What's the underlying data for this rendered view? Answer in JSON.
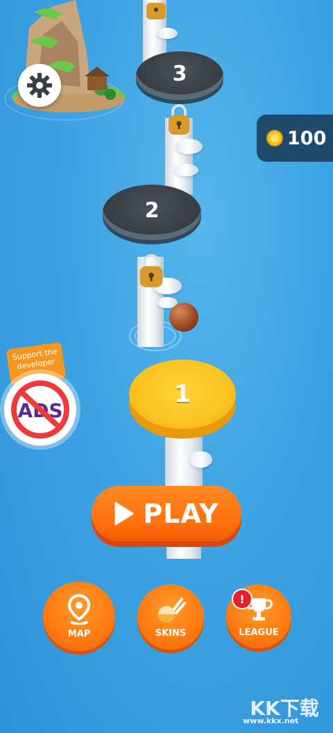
{
  "hud": {
    "coins": "100",
    "coin_icon": "coin-icon",
    "settings_icon": "gear-icon"
  },
  "levels": [
    {
      "number": "3",
      "state": "locked"
    },
    {
      "number": "2",
      "state": "locked"
    },
    {
      "number": "1",
      "state": "current"
    }
  ],
  "ads_promo": {
    "tag_text": "Support the developer",
    "badge_text": "ADS"
  },
  "play_button": {
    "label": "PLAY",
    "icon": "play-icon"
  },
  "bottom_nav": [
    {
      "label": "MAP",
      "icon": "map-pin-icon"
    },
    {
      "label": "SKINS",
      "icon": "ball-skin-icon"
    },
    {
      "label": "LEAGUE",
      "icon": "trophy-icon",
      "alert": "!"
    }
  ],
  "watermark": {
    "text": "www.kkx.net",
    "logo": "KK下载"
  },
  "colors": {
    "water": "#3ea3e3",
    "accent_orange": "#ff7a10",
    "gold_platform": "#fbc320",
    "locked_platform": "#3a3f46",
    "coin_panel": "#1f4a6b"
  }
}
